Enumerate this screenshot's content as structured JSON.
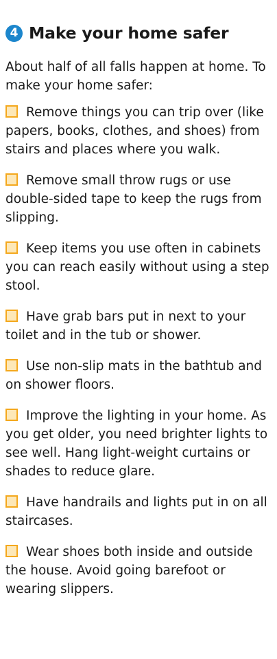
{
  "section": {
    "number": "4",
    "title": "Make your home safer"
  },
  "intro": "About half of all falls happen at home.  To make your home safer:",
  "checkbox_color": "#f4a81d",
  "checkbox_fill": "#fde8b8",
  "badge_color": "#1c86cc",
  "items": [
    "Remove things you can trip over (like papers, books, clothes, and shoes) from stairs and places where you walk.",
    "Remove small throw rugs or use double-sided tape to keep the rugs from slipping.",
    "Keep items you use often in cabinets you can reach easily without using a step stool.",
    "Have grab bars put in next to your toilet and in the tub or shower.",
    "Use non-slip mats in the bathtub and on shower floors.",
    "Improve the lighting in your home. As you get older, you need brighter lights to see well.  Hang light-weight curtains or shades to reduce glare.",
    "Have handrails and lights put in on all staircases.",
    "Wear shoes both inside and outside the house. Avoid going barefoot or wearing slippers."
  ]
}
